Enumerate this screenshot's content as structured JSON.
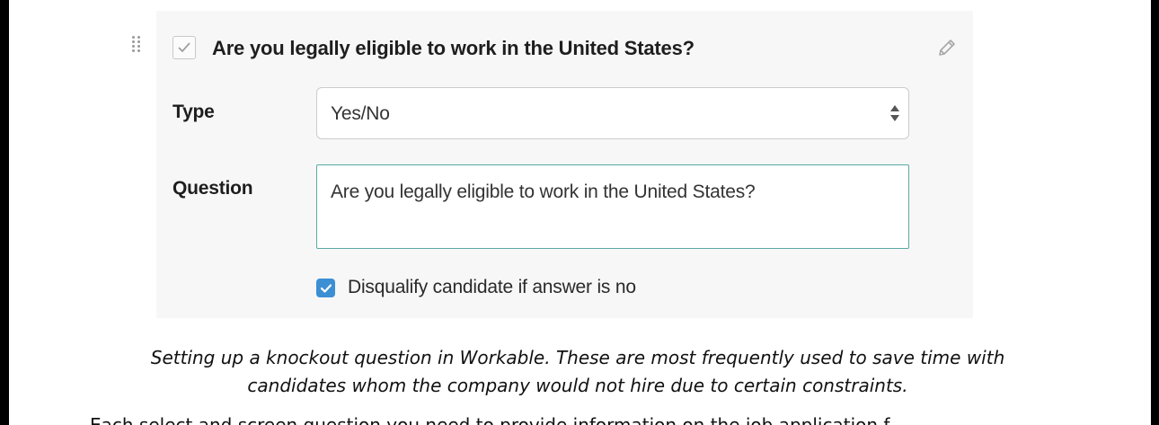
{
  "question_card": {
    "title": "Are you legally eligible to work in the United States?",
    "included": true,
    "type_label": "Type",
    "type_value": "Yes/No",
    "question_label": "Question",
    "question_value": "Are you legally eligible to work in the United States?",
    "disqualify_label": "Disqualify candidate if answer is no",
    "disqualify_checked": true
  },
  "icons": {
    "drag": "drag-handle-icon",
    "include": "checkmark-icon",
    "edit": "pencil-icon",
    "select": "select-arrows-icon",
    "disqualify": "checkmark-icon"
  },
  "colors": {
    "card_background": "#f7f7f7",
    "focus_border": "#59a9a4",
    "checkbox_checked": "#3d8fd4"
  },
  "caption": {
    "line1": "Setting up a knockout question in Workable. These are most frequently used to save time with",
    "line2": "candidates whom the company would not hire due to certain constraints."
  },
  "body_text_partial": "Each select and screen question you need to provide information on the job application f"
}
